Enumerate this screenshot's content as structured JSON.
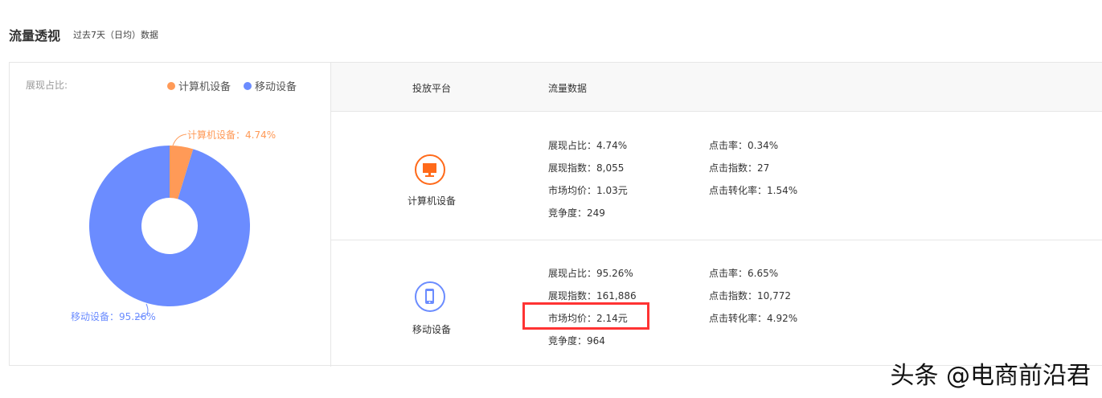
{
  "header": {
    "title": "流量透视",
    "subtitle": "过去7天（日均）数据"
  },
  "chart_data": {
    "type": "pie",
    "title": "展现占比:",
    "legend": [
      "计算机设备",
      "移动设备"
    ],
    "slices": [
      {
        "name": "计算机设备",
        "value": 4.74,
        "label": "计算机设备：4.74%",
        "color": "#ff9a57"
      },
      {
        "name": "移动设备",
        "value": 95.26,
        "label": "移动设备：95.26%",
        "color": "#6b8cff"
      }
    ],
    "donut": true
  },
  "table": {
    "headers": [
      "投放平台",
      "流量数据"
    ],
    "rows": [
      {
        "platform": "计算机设备",
        "icon": "monitor-icon",
        "color": "#ff6a1a",
        "col1": [
          "展现占比：4.74%",
          "展现指数：8,055",
          "市场均价：1.03元",
          "竞争度：249"
        ],
        "col2": [
          "点击率：0.34%",
          "点击指数：27",
          "点击转化率：1.54%"
        ]
      },
      {
        "platform": "移动设备",
        "icon": "phone-icon",
        "color": "#6b8cff",
        "col1": [
          "展现占比：95.26%",
          "展现指数：161,886",
          "市场均价：2.14元",
          "竞争度：964"
        ],
        "col2": [
          "点击率：6.65%",
          "点击指数：10,772",
          "点击转化率：4.92%"
        ]
      }
    ]
  },
  "watermark": "头条 @电商前沿君"
}
